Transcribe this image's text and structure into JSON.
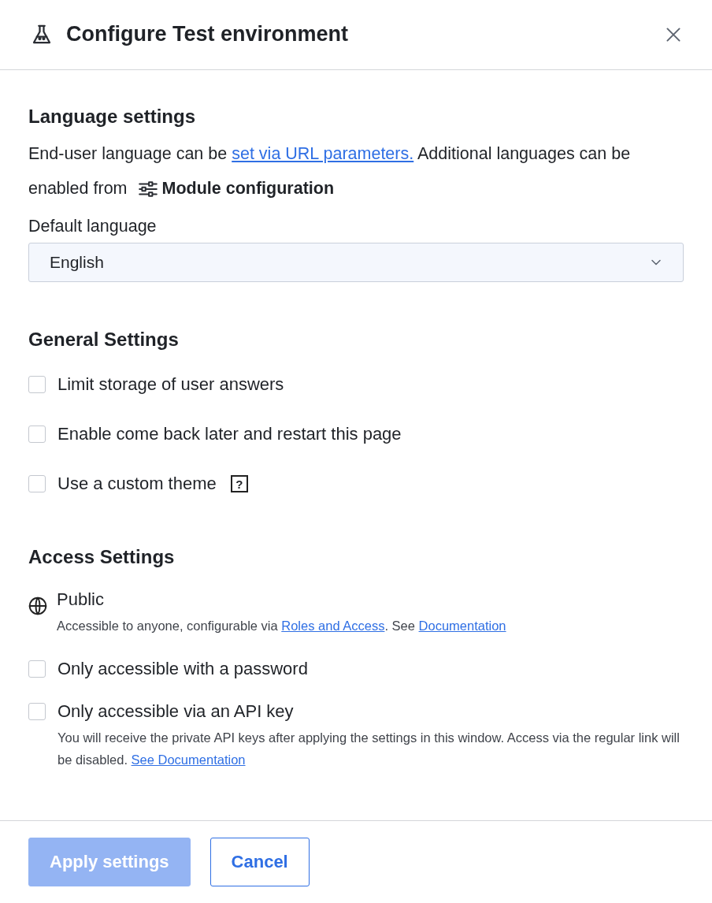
{
  "window": {
    "title": "Configure Test environment"
  },
  "language_settings": {
    "heading": "Language settings",
    "description": [
      {
        "kind": "text",
        "text": "End-user language can be "
      },
      {
        "kind": "link",
        "text": "set via URL parameters."
      },
      {
        "kind": "text",
        "text": " Additional languages can be enabled from "
      },
      {
        "kind": "module",
        "text": "Module configuration"
      }
    ],
    "default_language": {
      "label": "Default language",
      "value": "English"
    }
  },
  "general_settings": {
    "heading": "General Settings",
    "options": [
      {
        "label": "Limit storage of user answers",
        "checked": false
      },
      {
        "label": "Enable come back later and restart this page",
        "checked": false
      },
      {
        "label": "Use a custom theme",
        "checked": false,
        "help_mark": "?"
      }
    ]
  },
  "access_settings": {
    "heading": "Access Settings",
    "options": [
      {
        "kind": "info",
        "label": "Public",
        "description": [
          {
            "kind": "text",
            "text": "Accessible to anyone, configurable via "
          },
          {
            "kind": "link",
            "text": "Roles and Access"
          },
          {
            "kind": "text",
            "text": ". See "
          },
          {
            "kind": "link",
            "text": "Documentation"
          }
        ]
      },
      {
        "kind": "checkbox",
        "label": "Only accessible with a password",
        "checked": false
      },
      {
        "kind": "checkbox",
        "label": "Only accessible via an API key",
        "checked": false,
        "description": [
          {
            "kind": "text",
            "text": "You will receive the private API keys after applying the settings in this window. Access via the regular link will be disabled. "
          },
          {
            "kind": "link",
            "text": "See Documentation"
          }
        ]
      }
    ]
  },
  "buttons": [
    {
      "kind": "primary",
      "label": "Apply settings",
      "disabled": true
    },
    {
      "kind": "secondary",
      "label": "Cancel",
      "disabled": false
    }
  ]
}
